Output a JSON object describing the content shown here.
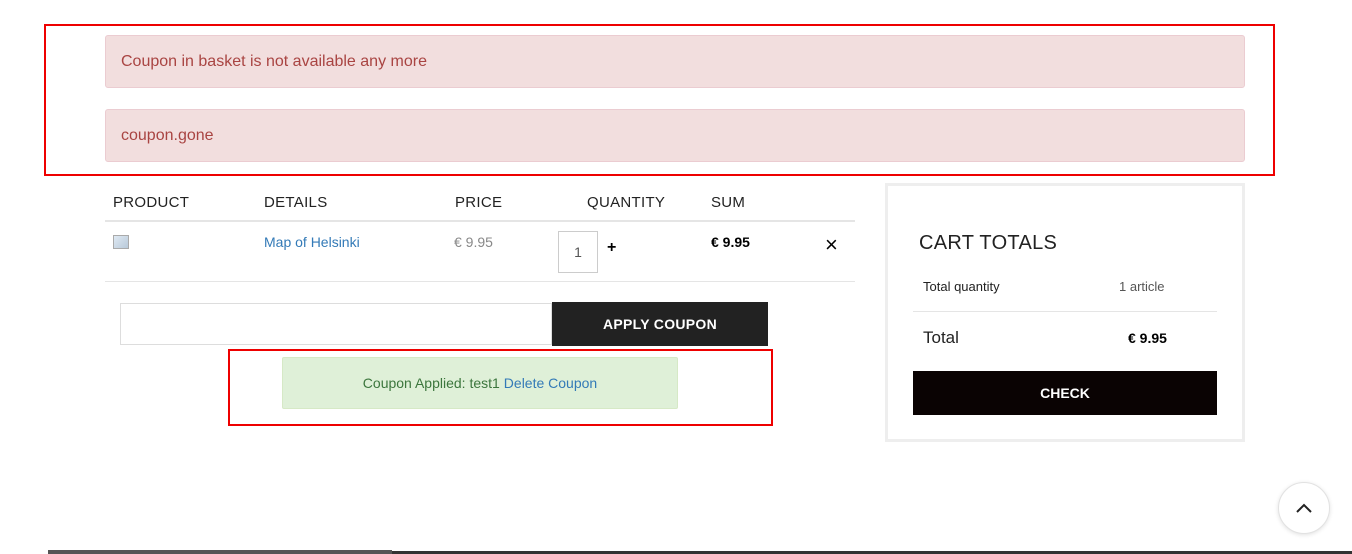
{
  "alerts": {
    "error_1": "Coupon in basket is not available any more",
    "error_2": "coupon.gone"
  },
  "cart": {
    "columns": {
      "product": "PRODUCT",
      "details": "DETAILS",
      "price": "PRICE",
      "quantity": "QUANTITY",
      "sum": "SUM"
    },
    "items": [
      {
        "name": "Map of Helsinki",
        "price": "€ 9.95",
        "quantity": "1",
        "plus": "+",
        "sum": "€ 9.95",
        "remove": "×"
      }
    ]
  },
  "coupon": {
    "input_value": "",
    "apply_label": "APPLY COUPON",
    "applied_text": "Coupon Applied: test1",
    "delete_label": "Delete Coupon"
  },
  "totals": {
    "title": "CART TOTALS",
    "quantity_label": "Total quantity",
    "quantity_value": "1 article",
    "total_label": "Total",
    "total_value": "€ 9.95",
    "check_label": "CHECK"
  },
  "colors": {
    "annotation": "#ee0000",
    "error_bg": "#f2dede",
    "error_text": "#a94442",
    "success_bg": "#dff0d8",
    "success_text": "#3c763d",
    "link": "#337ab7",
    "button_dark": "#222222"
  },
  "icons": {
    "remove": "close-icon",
    "scroll_top": "chevron-up-icon",
    "product_image": "broken-image-icon"
  }
}
